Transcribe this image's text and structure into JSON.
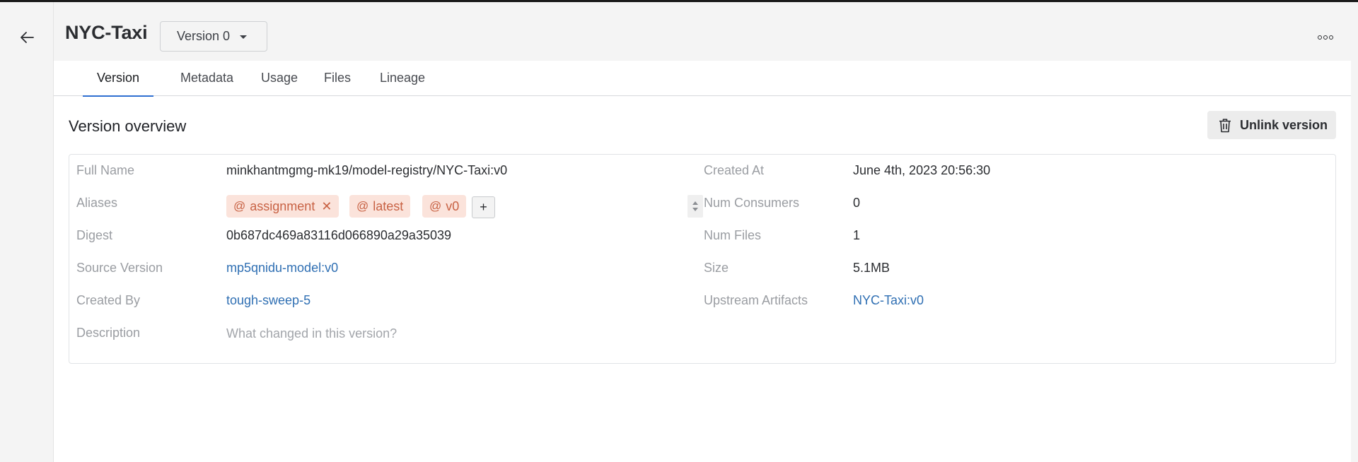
{
  "header": {
    "title": "NYC-Taxi",
    "version_select": "Version 0"
  },
  "tabs": [
    {
      "label": "Version",
      "active": true
    },
    {
      "label": "Metadata"
    },
    {
      "label": "Usage"
    },
    {
      "label": "Files"
    },
    {
      "label": "Lineage"
    }
  ],
  "overview": {
    "title": "Version overview",
    "unlink_label": "Unlink version",
    "left": {
      "full_name_label": "Full Name",
      "full_name": "minkhantmgmg-mk19/model-registry/NYC-Taxi:v0",
      "aliases_label": "Aliases",
      "aliases": [
        {
          "at": "@",
          "name": "assignment",
          "removable": true
        },
        {
          "at": "@",
          "name": "latest"
        },
        {
          "at": "@",
          "name": "v0"
        }
      ],
      "add_alias": "+",
      "digest_label": "Digest",
      "digest": "0b687dc469a83116d066890a29a35039",
      "source_version_label": "Source Version",
      "source_version": "mp5qnidu-model:v0",
      "created_by_label": "Created By",
      "created_by": "tough-sweep-5",
      "description_label": "Description",
      "description_placeholder": "What changed in this version?"
    },
    "right": {
      "created_at_label": "Created At",
      "created_at": "June 4th, 2023 20:56:30",
      "num_consumers_label": "Num Consumers",
      "num_consumers": "0",
      "num_files_label": "Num Files",
      "num_files": "1",
      "size_label": "Size",
      "size": "5.1MB",
      "upstream_label": "Upstream Artifacts",
      "upstream": "NYC-Taxi:v0"
    }
  },
  "colors": {
    "accent": "#2f6fd1",
    "link": "#2f6fb3",
    "alias_bg": "#fbe3db",
    "alias_text": "#c86244"
  },
  "icons": [
    "arrow-left-icon",
    "more-horizontal-icon",
    "caret-down-icon",
    "trash-icon",
    "close-icon",
    "plus-icon"
  ]
}
